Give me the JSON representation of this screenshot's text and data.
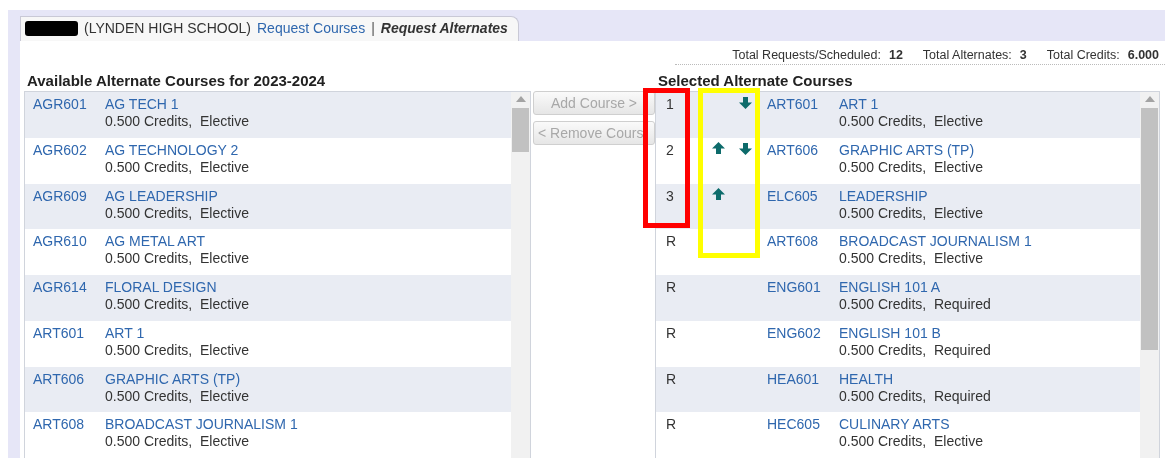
{
  "tab": {
    "school": "(LYNDEN HIGH SCHOOL)",
    "links": [
      {
        "label": "Request Courses",
        "selected": false
      },
      {
        "label": "Request Alternates",
        "selected": true
      }
    ],
    "separator": "|"
  },
  "totals": [
    {
      "label": "Total Requests/Scheduled:",
      "value": "12"
    },
    {
      "label": "Total Alternates:",
      "value": "3"
    },
    {
      "label": "Total Credits:",
      "value": "6.000"
    }
  ],
  "available": {
    "title": "Available Alternate Courses for 2023-2024",
    "courses": [
      {
        "code": "AGR601",
        "name": "AG TECH 1",
        "detail": "0.500 Credits,  Elective"
      },
      {
        "code": "AGR602",
        "name": "AG TECHNOLOGY 2",
        "detail": "0.500 Credits,  Elective"
      },
      {
        "code": "AGR609",
        "name": "AG LEADERSHIP",
        "detail": "0.500 Credits,  Elective"
      },
      {
        "code": "AGR610",
        "name": "AG METAL ART",
        "detail": "0.500 Credits,  Elective"
      },
      {
        "code": "AGR614",
        "name": "FLORAL DESIGN",
        "detail": "0.500 Credits,  Elective"
      },
      {
        "code": "ART601",
        "name": "ART 1",
        "detail": "0.500 Credits,  Elective"
      },
      {
        "code": "ART606",
        "name": "GRAPHIC ARTS (TP)",
        "detail": "0.500 Credits,  Elective"
      },
      {
        "code": "ART608",
        "name": "BROADCAST JOURNALISM 1",
        "detail": "0.500 Credits,  Elective"
      }
    ]
  },
  "buttons": [
    {
      "label": "Add Course >",
      "disabled": true
    },
    {
      "label": "< Remove Cours",
      "disabled": true
    }
  ],
  "selected": {
    "title": "Selected Alternate Courses",
    "courses": [
      {
        "rank": "1",
        "move_up": false,
        "move_down": true,
        "code": "ART601",
        "name": "ART 1",
        "detail": "0.500 Credits,  Elective"
      },
      {
        "rank": "2",
        "move_up": true,
        "move_down": true,
        "code": "ART606",
        "name": "GRAPHIC ARTS (TP)",
        "detail": "0.500 Credits,  Elective"
      },
      {
        "rank": "3",
        "move_up": true,
        "move_down": false,
        "code": "ELC605",
        "name": "LEADERSHIP",
        "detail": "0.500 Credits,  Elective"
      },
      {
        "rank": "R",
        "move_up": false,
        "move_down": false,
        "code": "ART608",
        "name": "BROADCAST JOURNALISM 1",
        "detail": "0.500 Credits,  Elective"
      },
      {
        "rank": "R",
        "move_up": false,
        "move_down": false,
        "code": "ENG601",
        "name": "ENGLISH 101 A",
        "detail": "0.500 Credits,  Required"
      },
      {
        "rank": "R",
        "move_up": false,
        "move_down": false,
        "code": "ENG602",
        "name": "ENGLISH 101 B",
        "detail": "0.500 Credits,  Required"
      },
      {
        "rank": "R",
        "move_up": false,
        "move_down": false,
        "code": "HEA601",
        "name": "HEALTH",
        "detail": "0.500 Credits,  Required"
      },
      {
        "rank": "R",
        "move_up": false,
        "move_down": false,
        "code": "HEC605",
        "name": "CULINARY ARTS",
        "detail": "0.500 Credits,  Elective"
      }
    ]
  },
  "annotations": [
    {
      "color": "#ff0000"
    },
    {
      "color": "#ffff00"
    }
  ]
}
